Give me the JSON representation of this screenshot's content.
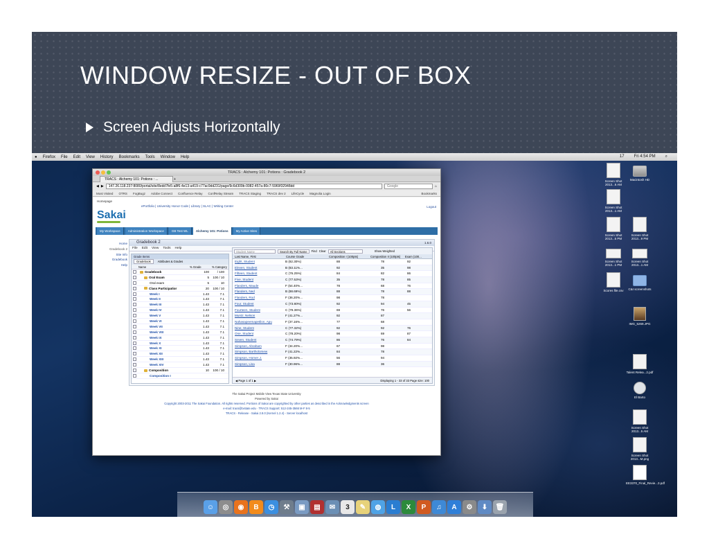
{
  "slide": {
    "title": "WINDOW RESIZE - OUT OF BOX",
    "bullet": "Screen Adjusts Horizontally"
  },
  "menubar": {
    "items": [
      "Firefox",
      "File",
      "Edit",
      "View",
      "History",
      "Bookmarks",
      "Tools",
      "Window",
      "Help"
    ],
    "clock": "Fri 4:54 PM",
    "battery": "17"
  },
  "browser": {
    "window_title": "TRACS : Alchemy 101: Potions : Gradebook 2",
    "tab_title": "TRACS : Alchemy 101: Potions : ...",
    "url": "147.26.118.237:8080/portal/site/8edd7fe5-a8f6-4e13-a419-c77ac9dd231/page/9c6d309b-0082-457a-80c7-5969f32948dd",
    "search_placeholder": "Google",
    "bookmarks_label": "Bookmarks",
    "bookmarks": [
      "Most Visited",
      "OTRS",
      "FogBugz",
      "Adobe Connect",
      "Confluence Relay",
      "ConfRelay Stream",
      "TRACS Staging",
      "TRACS dev 2",
      "LifeCycle",
      "Magnolia Login"
    ]
  },
  "sakai": {
    "homepage_label": "Homepage",
    "top_links": "ePortfolio | University Honor Code | Library | SLAC | Writing Center",
    "logout": "Logout",
    "logo": "Sakai",
    "site_tabs": [
      "My Workspace",
      "Administration Workspace",
      "GB Test WL",
      "Alchemy 101: Potions",
      "My Active Sites"
    ],
    "tool_menu": [
      "Home",
      "Gradebook 2",
      "Site Info",
      "Gradebook",
      "Help"
    ]
  },
  "gradebook": {
    "title": "Gradebook 2",
    "version": "1.6.0",
    "menu": [
      "File",
      "Edit",
      "View",
      "Tools",
      "Help"
    ],
    "tree_header": "Grade Items",
    "tree_tabs": [
      "Gradebook",
      "Attributes & Grades"
    ],
    "tree_columns": [
      "Name",
      "% Grade",
      "% Category"
    ],
    "tree_rows": [
      {
        "name": "Gradebook",
        "grade": "100",
        "cat": "/ 100",
        "kind": "cat"
      },
      {
        "name": "Oral Exam",
        "grade": "5",
        "cat": "100 / 10",
        "kind": "cat"
      },
      {
        "name": "Oral exam",
        "grade": "5",
        "cat": "10",
        "kind": "plain"
      },
      {
        "name": "Class Participatior",
        "grade": "20",
        "cat": "100 / 10",
        "kind": "cat"
      },
      {
        "name": "Week I",
        "grade": "1.43",
        "cat": "7.1",
        "kind": "item"
      },
      {
        "name": "Week II",
        "grade": "1.43",
        "cat": "7.1",
        "kind": "item"
      },
      {
        "name": "Week III",
        "grade": "1.43",
        "cat": "7.1",
        "kind": "item"
      },
      {
        "name": "Week IV",
        "grade": "1.43",
        "cat": "7.1",
        "kind": "item"
      },
      {
        "name": "Week V",
        "grade": "1.43",
        "cat": "7.1",
        "kind": "item"
      },
      {
        "name": "Week VI",
        "grade": "1.43",
        "cat": "7.1",
        "kind": "item"
      },
      {
        "name": "Week VII",
        "grade": "1.43",
        "cat": "7.1",
        "kind": "item"
      },
      {
        "name": "Week VIII",
        "grade": "1.43",
        "cat": "7.1",
        "kind": "item"
      },
      {
        "name": "Week IX",
        "grade": "1.43",
        "cat": "7.1",
        "kind": "item"
      },
      {
        "name": "Week X",
        "grade": "1.43",
        "cat": "7.1",
        "kind": "item"
      },
      {
        "name": "Week XI",
        "grade": "1.43",
        "cat": "7.1",
        "kind": "item"
      },
      {
        "name": "Week XII",
        "grade": "1.43",
        "cat": "7.1",
        "kind": "item"
      },
      {
        "name": "Week XIII",
        "grade": "1.43",
        "cat": "7.1",
        "kind": "item"
      },
      {
        "name": "Week XIV",
        "grade": "1.43",
        "cat": "7.1",
        "kind": "item"
      },
      {
        "name": "Composition",
        "grade": "10",
        "cat": "100 / 10",
        "kind": "cat"
      },
      {
        "name": "Composition I",
        "grade": "",
        "cat": "",
        "kind": "item"
      }
    ],
    "grid_toolbar": {
      "student_name_placeholder": "Student Name",
      "search_by": "Search By Full Name",
      "find": "Find",
      "clear": "Clear",
      "sections": "All Sections",
      "show_weighted": "Show Weighted"
    },
    "grid_columns": [
      "Last Name, First",
      "Course Grade",
      "Composition I (100pts)",
      "Composition II (100pts)",
      "Exam (100..."
    ],
    "grid_rows": [
      [
        "Eight, Student",
        "B (82.30%)",
        "88",
        "78",
        "92"
      ],
      [
        "Eleven, Student",
        "B (83.11%...",
        "92",
        "35",
        "98"
      ],
      [
        "Fifteen, Student",
        "C (76.25%)",
        "84",
        "82",
        "86"
      ],
      [
        "Five, Student",
        "C (77.53%)",
        "35",
        "78",
        "85"
      ],
      [
        "Flanders, Maude",
        "F (54.40%...",
        "78",
        "68",
        "76"
      ],
      [
        "Flanders, Ned",
        "B (88.69%)",
        "88",
        "78",
        "88"
      ],
      [
        "Flanders, Rod",
        "F (36.20%...",
        "98",
        "78",
        ""
      ],
      [
        "Four, Student",
        "C (73.80%)",
        "92",
        "94",
        "45"
      ],
      [
        "Fourteen, Student",
        "C (79.36%)",
        "69",
        "76",
        "56"
      ],
      [
        "Muntz, Nelson",
        "F (41.27%...",
        "92",
        "87",
        ""
      ],
      [
        "Nahasapeemapetilon, Apu",
        "F (37.16%...",
        "77",
        "68",
        ""
      ],
      [
        "Nine, Student",
        "C (77.32%)",
        "92",
        "92",
        "76"
      ],
      [
        "One, Student",
        "C (78.20%)",
        "98",
        "69",
        "87"
      ],
      [
        "Seven, Student",
        "C (74.79%)",
        "86",
        "76",
        "84"
      ],
      [
        "Simpson, Abraham",
        "F (34.20%...",
        "67",
        "98",
        ""
      ],
      [
        "Simpson, Bartholomew",
        "F (41.22%...",
        "84",
        "78",
        ""
      ],
      [
        "Simpson, Homer J.",
        "F (35.92%...",
        "56",
        "94",
        ""
      ],
      [
        "Simpson, Lisa",
        "F (30.96%...",
        "88",
        "36",
        ""
      ]
    ],
    "page_label": "Page",
    "page_value": "1",
    "page_of": "of 1",
    "displaying": "Displaying 1 - 33 of 33",
    "page_size_label": "Page size:",
    "page_size": "100"
  },
  "footer": {
    "links": "The Sakai Project   Mobile View   Texas State University",
    "powered": "Powered by Sakai",
    "copyright": "Copyright 2003-2011 The Sakai Foundation. All rights reserved. Portions of Sakai are copyrighted by other parties as described in the Acknowledgments screen",
    "contact": "e-mail: tracs@txstate.edu · TRACS Support: 512-245-3566 M-F 8-5",
    "build": "TRACS - Release - Sakai 2.8.0 (Kernel 1.2.4) - Server localhost"
  },
  "desktop_icons": [
    {
      "label": "Macintosh HD",
      "kind": "hd"
    },
    {
      "label": "Screen Shot 2013...6 AM",
      "kind": "doc"
    },
    {
      "label": "Screen Shot 2013...1 AM",
      "kind": "doc"
    },
    {
      "label": "Screen Shot 2013...5 PM",
      "kind": "doc"
    },
    {
      "label": "Screen Shot 2013...9 PM",
      "kind": "doc"
    },
    {
      "label": "Screen Shot 2013...1 PM",
      "kind": "wide"
    },
    {
      "label": "Screen Shot 2013...1 AM",
      "kind": "wide"
    },
    {
      "label": "Scores file.csv",
      "kind": "doc"
    },
    {
      "label": "C&I screenshots",
      "kind": "folder"
    },
    {
      "label": "IMG_5269.JPG",
      "kind": "photo"
    },
    {
      "label": "Talent Relea...2.pdf",
      "kind": "doc"
    },
    {
      "label": "El Barto",
      "kind": "clock"
    },
    {
      "label": "Screen Shot 2013...5 AM",
      "kind": "doc"
    },
    {
      "label": "Screen Shot 2013...M.png",
      "kind": "doc"
    },
    {
      "label": "EE3370_Final_Revie...3.pdf",
      "kind": "lock"
    }
  ],
  "dock": {
    "apps": [
      {
        "name": "finder",
        "glyph": "☺",
        "color": "#5aa0e8"
      },
      {
        "name": "launchpad",
        "glyph": "◎",
        "color": "#8d8d8d"
      },
      {
        "name": "firefox",
        "glyph": "◉",
        "color": "#e8731e"
      },
      {
        "name": "blogger",
        "glyph": "B",
        "color": "#f28b1c"
      },
      {
        "name": "safari",
        "glyph": "◷",
        "color": "#3b8fe0"
      },
      {
        "name": "xcode",
        "glyph": "⚒",
        "color": "#6f7d8c"
      },
      {
        "name": "preview",
        "glyph": "▣",
        "color": "#7a9bc3"
      },
      {
        "name": "photo-booth",
        "glyph": "▤",
        "color": "#b13030"
      },
      {
        "name": "mail",
        "glyph": "✉",
        "color": "#6b8fb5"
      },
      {
        "name": "calendar",
        "glyph": "3",
        "color": "#e8e8e8"
      },
      {
        "name": "notes",
        "glyph": "✎",
        "color": "#e7d27a"
      },
      {
        "name": "messages",
        "glyph": "◍",
        "color": "#4fa3e6"
      },
      {
        "name": "lync",
        "glyph": "L",
        "color": "#2a7dd1"
      },
      {
        "name": "excel",
        "glyph": "X",
        "color": "#2c8a3c"
      },
      {
        "name": "powerpoint",
        "glyph": "P",
        "color": "#d15a20"
      },
      {
        "name": "itunes",
        "glyph": "♫",
        "color": "#3e89d6"
      },
      {
        "name": "app-store",
        "glyph": "A",
        "color": "#2f7fd8"
      },
      {
        "name": "system-preferences",
        "glyph": "⚙",
        "color": "#8a8a8a"
      },
      {
        "name": "downloads",
        "glyph": "⬇",
        "color": "#5f8ac4"
      },
      {
        "name": "trash",
        "glyph": "🗑",
        "color": "#9aa3ad"
      }
    ]
  }
}
